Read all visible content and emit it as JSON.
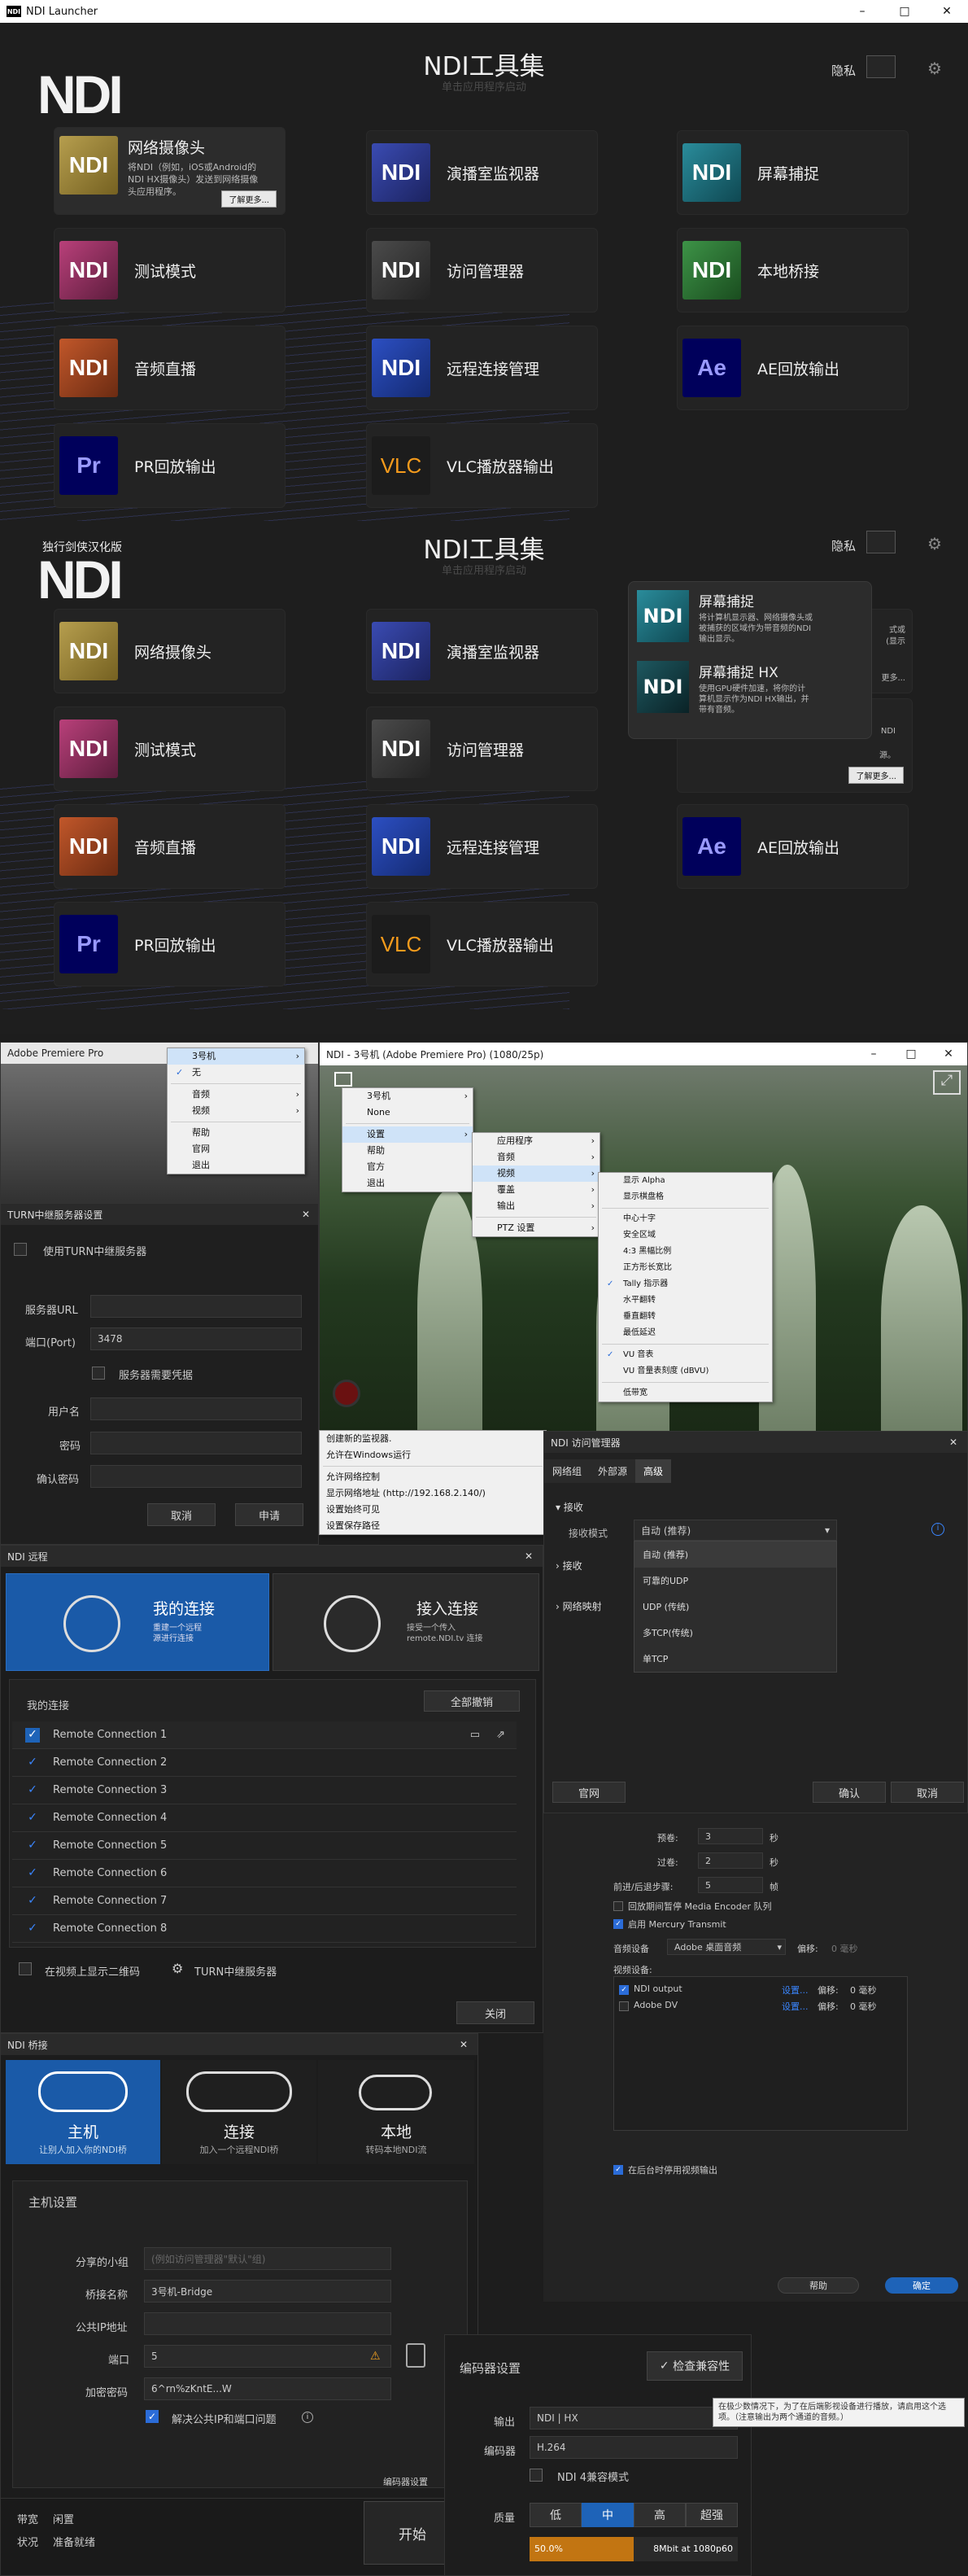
{
  "app": {
    "window_title": "NDI Launcher",
    "icon_text": "NDI"
  },
  "window_buttons": {
    "minimize": "–",
    "maximize": "□",
    "close": "✕"
  },
  "launcher1": {
    "logo": "NDI",
    "title": "NDI工具集",
    "subtitle": "单击应用程序启动",
    "privacy_label": "隐私",
    "tiles": [
      {
        "label": "网络摄像头",
        "icon": "NDI",
        "desc": "将NDI（例如，iOS或Android的NDI HX摄像头）发送到网络摄像头应用程序。",
        "more": "了解更多..."
      },
      {
        "label": "演播室监视器",
        "icon": "NDI"
      },
      {
        "label": "屏幕捕捉",
        "icon": "NDI"
      },
      {
        "label": "测试模式",
        "icon": "NDI"
      },
      {
        "label": "访问管理器",
        "icon": "NDI"
      },
      {
        "label": "本地桥接",
        "icon": "NDI"
      },
      {
        "label": "音频直播",
        "icon": "NDI"
      },
      {
        "label": "远程连接管理",
        "icon": "NDI"
      },
      {
        "label": "AE回放输出",
        "icon": "Ae"
      },
      {
        "label": "PR回放输出",
        "icon": "Pr"
      },
      {
        "label": "VLC播放器输出",
        "icon": "VLC"
      }
    ]
  },
  "launcher2": {
    "logo_caption": "独行剑侠汉化版",
    "logo": "NDI",
    "title": "NDI工具集",
    "subtitle": "单击应用程序启动",
    "privacy_label": "隐私",
    "tiles": [
      {
        "label": "网络摄像头",
        "icon": "NDI"
      },
      {
        "label": "演播室监视器",
        "icon": "NDI"
      },
      {
        "label": "测试模式",
        "icon": "NDI"
      },
      {
        "label": "访问管理器",
        "icon": "NDI"
      },
      {
        "label": "音频直播",
        "icon": "NDI"
      },
      {
        "label": "远程连接管理",
        "icon": "NDI"
      },
      {
        "label": "AE回放输出",
        "icon": "Ae"
      },
      {
        "label": "PR回放输出",
        "icon": "Pr"
      },
      {
        "label": "VLC播放器输出",
        "icon": "VLC"
      }
    ],
    "popup": {
      "items": [
        {
          "title": "屏幕捕捉",
          "icon": "NDI",
          "desc": "将计算机显示器、网络摄像头或被捕获的区域作为带音频的NDI输出显示。"
        },
        {
          "title": "屏幕捕捉 HX",
          "icon": "NDI",
          "desc": "使用GPU硬件加速，将你的计算机显示作为NDI HX输出，并带有音频。"
        }
      ],
      "more": "了解更多...",
      "peek1": "更多...",
      "peek2": "式或",
      "peek3": "(显示",
      "peek4": "NDI",
      "peek5": "源。"
    }
  },
  "premiere_menu": {
    "title": "Adobe Premiere Pro",
    "items": [
      "3号机",
      "无",
      "音频",
      "视频",
      "帮助",
      "官网",
      "退出"
    ]
  },
  "monitor": {
    "title": "NDI - 3号机 (Adobe Premiere Pro) (1080/25p)",
    "menu1": [
      "3号机",
      "None",
      "设置",
      "帮助",
      "官方",
      "退出"
    ],
    "menu2": [
      "应用程序",
      "音频",
      "视频",
      "覆盖",
      "输出",
      "PTZ 设置"
    ],
    "menu3": [
      "显示 Alpha",
      "显示棋盘格",
      "中心十字",
      "安全区域",
      "4:3 黑幅比例",
      "正方形长宽比",
      "Tally 指示器",
      "水平翻转",
      "垂直翻转",
      "最低延迟",
      "VU 音表",
      "VU 音量表刻度 (dBVU)",
      "低带宽"
    ],
    "menu3_checked": [
      6,
      10
    ],
    "menu4": [
      "创建新的监视器.",
      "允许在Windows运行",
      "允许网络控制",
      "显示网络地址 (http://192.168.2.140/)",
      "设置始终可见",
      "设置保存路径"
    ]
  },
  "turn": {
    "title": "TURN中继服务器设置",
    "use_label": "使用TURN中继服务器",
    "url_label": "服务器URL",
    "url_value": "",
    "port_label": "端口(Port)",
    "port_value": "3478",
    "cred_label": "服务器需要凭据",
    "user_label": "用户名",
    "pass_label": "密码",
    "confirm_label": "确认密码",
    "cancel": "取消",
    "apply": "申请"
  },
  "access": {
    "title": "NDI 访问管理器",
    "tabs": [
      "网络组",
      "外部源",
      "高级"
    ],
    "recv_section": "接收",
    "recv_mode_label": "接收模式",
    "recv_mode_value": "自动 (推荐)",
    "options": [
      "自动 (推荐)",
      "可靠的UDP",
      "UDP (传统)",
      "多TCP(传统)",
      "单TCP"
    ],
    "sec2": "接收",
    "sec3": "网络映射",
    "website": "官网",
    "ok": "确认",
    "cancel": "取消"
  },
  "remote": {
    "title": "NDI 远程",
    "tab1_title": "我的连接",
    "tab1_desc": "重建一个远程\n源进行连接",
    "tab2_title": "接入连接",
    "tab2_desc": "接受一个传入\nremote.NDI.tv 连接",
    "list_title": "我的连接",
    "clear_all": "全部撤销",
    "rows": [
      "Remote Connection 1",
      "Remote Connection 2",
      "Remote Connection 3",
      "Remote Connection 4",
      "Remote Connection 5",
      "Remote Connection 6",
      "Remote Connection 7",
      "Remote Connection 8"
    ],
    "qr_label": "在视频上显示二维码",
    "turn_label": "TURN中继服务器",
    "close": "关闭"
  },
  "premiere_settings": {
    "preroll_label": "预卷:",
    "preroll_value": "3",
    "preroll_unit": "秒",
    "postroll_label": "过卷:",
    "postroll_value": "2",
    "postroll_unit": "秒",
    "step_label": "前进/后退步骤:",
    "step_value": "5",
    "step_unit": "帧",
    "mute_label": "回放期间暂停 Media Encoder 队列",
    "mercury_label": "启用 Mercury Transmit",
    "audio_dev_label": "音频设备",
    "audio_dev_value": "Adobe 桌面音频",
    "offset_label": "偏移:",
    "offset_value": "0 毫秒",
    "video_dev_label": "视频设备:",
    "video_devs": [
      {
        "name": "NDI output",
        "setup": "设置...",
        "offset": "偏移:",
        "value": "0 毫秒",
        "checked": true
      },
      {
        "name": "Adobe DV",
        "setup": "设置...",
        "offset": "偏移:",
        "value": "0 毫秒",
        "checked": false
      }
    ],
    "bg_label": "在后台时停用视频输出",
    "help": "帮助",
    "ok": "确定"
  },
  "bridge": {
    "title": "NDI 桥接",
    "tabs": [
      {
        "title": "主机",
        "desc": "让别人加入你的NDI桥"
      },
      {
        "title": "连接",
        "desc": "加入一个远程NDI桥"
      },
      {
        "title": "本地",
        "desc": "转码本地NDI流"
      }
    ],
    "section": "主机设置",
    "group_label": "分享的小组",
    "group_placeholder": "(例如访问管理器\"默认\"组)",
    "name_label": "桥接名称",
    "name_value": "3号机-Bridge",
    "ip_label": "公共IP地址",
    "ip_value": "",
    "port_label": "端口",
    "port_value": "5",
    "key_label": "加密密码",
    "key_value": "6^rn%zKntE...W",
    "fix_label": "解决公共IP和端口问题",
    "encoder_label": "编码器设置",
    "share_label": "带宽",
    "share_value": "闲置",
    "status_label": "状况",
    "status_value": "准备就绪",
    "start": "开始"
  },
  "encoder": {
    "title": "编码器设置",
    "compat": "检查兼容性",
    "output_label": "输出",
    "output_value": "NDI | HX",
    "codec_label": "编码器",
    "codec_value": "H.264",
    "ndi4_label": "NDI 4兼容模式",
    "quality_label": "质量",
    "qualities": [
      "低",
      "中",
      "高",
      "超强"
    ],
    "quality_selected": 1,
    "bitrate_pct": "50.0%",
    "bitrate_text": "8Mbit at 1080p60",
    "tooltip": "在极少数情况下，为了在后端影视设备进行播放，请启用这个选项。（注意输出为两个通道的音频。）"
  }
}
